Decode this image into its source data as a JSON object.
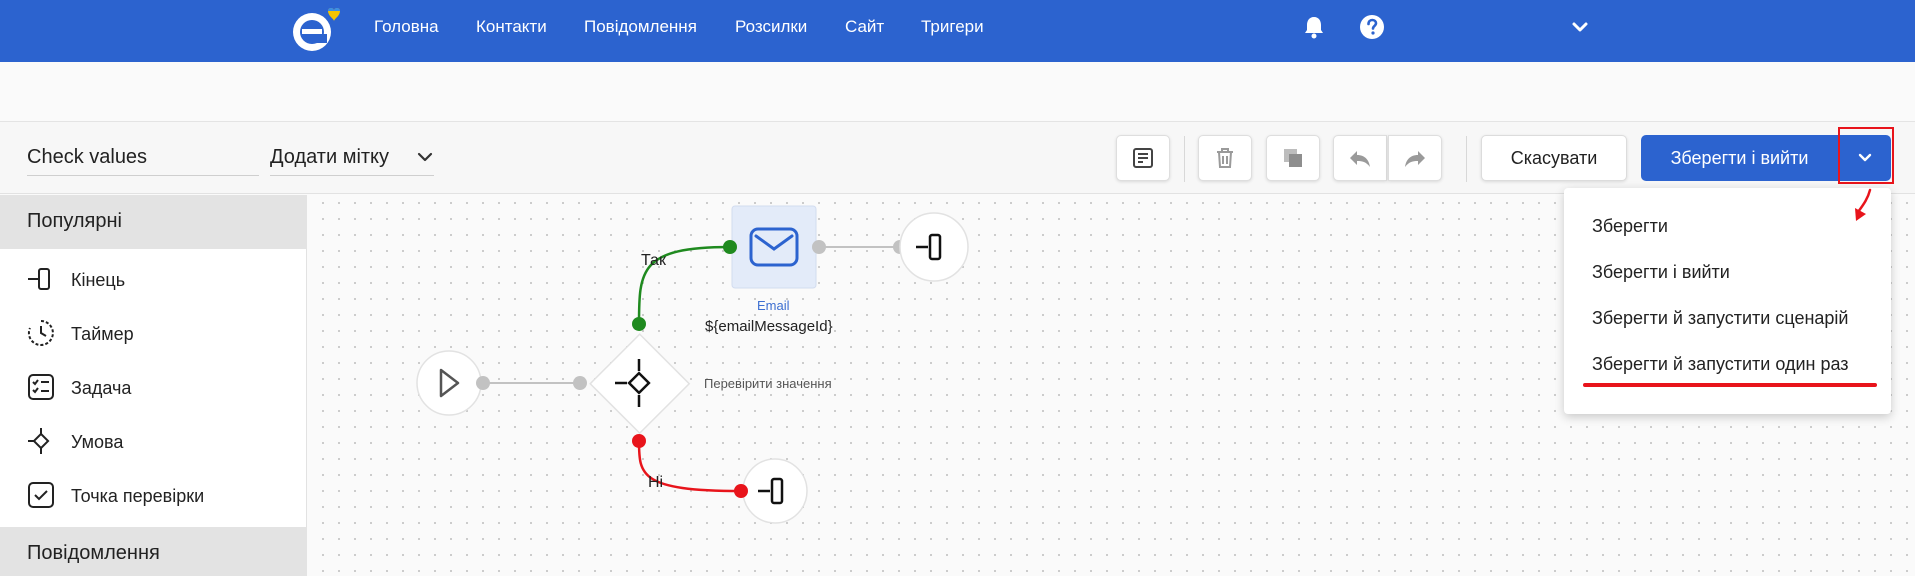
{
  "nav": {
    "items": [
      "Головна",
      "Контакти",
      "Повідомлення",
      "Розсилки",
      "Сайт",
      "Тригери"
    ],
    "icons": [
      "bell-icon",
      "help-icon",
      "chevron-down-icon"
    ],
    "accent_color": "#2c63cf"
  },
  "toolbar": {
    "scenario_name": "Check values",
    "tag_select_label": "Додати мітку",
    "cancel_label": "Скасувати",
    "save_exit_label": "Зберегти і вийти",
    "icons": [
      "notes-icon",
      "trash-icon",
      "copy-icon",
      "undo-icon",
      "redo-icon"
    ]
  },
  "sidebar": {
    "sections": [
      "Популярні",
      "Повідомлення"
    ],
    "items": [
      {
        "label": "Кінець",
        "icon": "end-icon"
      },
      {
        "label": "Таймер",
        "icon": "timer-icon"
      },
      {
        "label": "Задача",
        "icon": "task-icon"
      },
      {
        "label": "Умова",
        "icon": "condition-icon"
      },
      {
        "label": "Точка перевірки",
        "icon": "checkpoint-icon"
      }
    ]
  },
  "canvas": {
    "condition_label": "Перевірити значення",
    "yes_label": "Так",
    "no_label": "Ні",
    "email_label": "Email",
    "email_message_id": "${emailMessageId}",
    "yes_color": "#1f8a1f",
    "no_color": "#e8141b"
  },
  "dropdown": {
    "items": [
      "Зберегти",
      "Зберегти і вийти",
      "Зберегти й запустити сценарій",
      "Зберегти й запустити один раз"
    ],
    "highlight_color": "#e8141b"
  }
}
